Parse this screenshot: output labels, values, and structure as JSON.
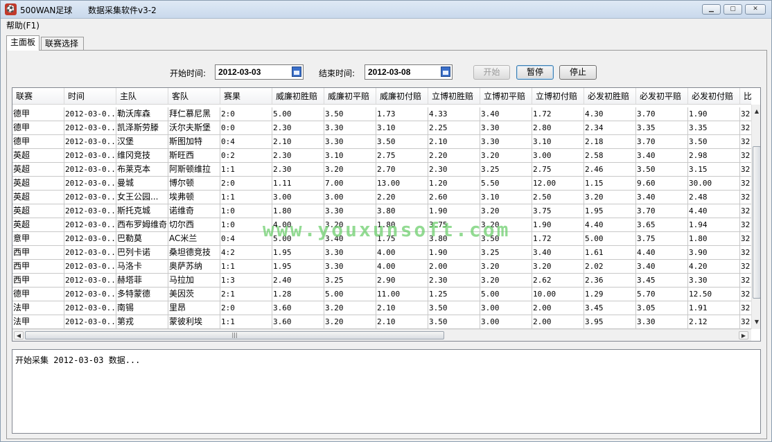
{
  "window": {
    "app_title": "500WAN足球",
    "doc_title": "数据采集软件v3-2",
    "icon_name": "app-logo-icon"
  },
  "menu": {
    "help": "帮助(F1)"
  },
  "tabs": [
    {
      "label": "主面板",
      "active": true
    },
    {
      "label": "联赛选择",
      "active": false
    }
  ],
  "controls": {
    "start_label": "开始时间:",
    "start_date": "2012-03-03",
    "end_label": "结束时间:",
    "end_date": "2012-03-08",
    "btn_start": "开始",
    "btn_pause": "暂停",
    "btn_stop": "停止"
  },
  "table": {
    "columns": [
      "联赛",
      "时间",
      "主队",
      "客队",
      "赛果",
      "威廉初胜赔",
      "威廉初平赔",
      "威廉初付赔",
      "立博初胜赔",
      "立博初平赔",
      "立博初付赔",
      "必发初胜赔",
      "必发初平赔",
      "必发初付赔",
      "比"
    ],
    "rows": [
      [
        "德甲",
        "2012-03-0...",
        "勒沃库森",
        "拜仁慕尼黑",
        "2:0",
        "5.00",
        "3.50",
        "1.73",
        "4.33",
        "3.40",
        "1.72",
        "4.30",
        "3.70",
        "1.90",
        "32"
      ],
      [
        "德甲",
        "2012-03-0...",
        "凯泽斯劳滕",
        "沃尔夫斯堡",
        "0:0",
        "2.30",
        "3.30",
        "3.10",
        "2.25",
        "3.30",
        "2.80",
        "2.34",
        "3.35",
        "3.35",
        "32"
      ],
      [
        "德甲",
        "2012-03-0...",
        "汉堡",
        "斯图加特",
        "0:4",
        "2.10",
        "3.30",
        "3.50",
        "2.10",
        "3.30",
        "3.10",
        "2.18",
        "3.70",
        "3.50",
        "32"
      ],
      [
        "英超",
        "2012-03-0...",
        "维冈竞技",
        "斯旺西",
        "0:2",
        "2.30",
        "3.10",
        "2.75",
        "2.20",
        "3.20",
        "3.00",
        "2.58",
        "3.40",
        "2.98",
        "32"
      ],
      [
        "英超",
        "2012-03-0...",
        "布莱克本",
        "阿斯顿维拉",
        "1:1",
        "2.30",
        "3.20",
        "2.70",
        "2.30",
        "3.25",
        "2.75",
        "2.46",
        "3.50",
        "3.15",
        "32"
      ],
      [
        "英超",
        "2012-03-0...",
        "曼城",
        "博尔顿",
        "2:0",
        "1.11",
        "7.00",
        "13.00",
        "1.20",
        "5.50",
        "12.00",
        "1.15",
        "9.60",
        "30.00",
        "32"
      ],
      [
        "英超",
        "2012-03-0...",
        "女王公园...",
        "埃弗顿",
        "1:1",
        "3.00",
        "3.00",
        "2.20",
        "2.60",
        "3.10",
        "2.50",
        "3.20",
        "3.40",
        "2.48",
        "32"
      ],
      [
        "英超",
        "2012-03-0...",
        "斯托克城",
        "诺维奇",
        "1:0",
        "1.80",
        "3.30",
        "3.80",
        "1.90",
        "3.20",
        "3.75",
        "1.95",
        "3.70",
        "4.40",
        "32"
      ],
      [
        "英超",
        "2012-03-0...",
        "西布罗姆维奇",
        "切尔西",
        "1:0",
        "4.00",
        "3.20",
        "1.80",
        "3.75",
        "3.20",
        "1.90",
        "4.40",
        "3.65",
        "1.94",
        "32"
      ],
      [
        "意甲",
        "2012-03-0...",
        "巴勒莫",
        "AC米兰",
        "0:4",
        "5.00",
        "3.40",
        "1.75",
        "3.80",
        "3.50",
        "1.72",
        "5.00",
        "3.75",
        "1.80",
        "32"
      ],
      [
        "西甲",
        "2012-03-0...",
        "巴列卡诺",
        "桑坦德竞技",
        "4:2",
        "1.95",
        "3.30",
        "4.00",
        "1.90",
        "3.25",
        "3.40",
        "1.61",
        "4.40",
        "3.90",
        "32"
      ],
      [
        "西甲",
        "2012-03-0...",
        "马洛卡",
        "奥萨苏纳",
        "1:1",
        "1.95",
        "3.30",
        "4.00",
        "2.00",
        "3.20",
        "3.20",
        "2.02",
        "3.40",
        "4.20",
        "32"
      ],
      [
        "西甲",
        "2012-03-0...",
        "赫塔菲",
        "马拉加",
        "1:3",
        "2.40",
        "3.25",
        "2.90",
        "2.30",
        "3.20",
        "2.62",
        "2.36",
        "3.45",
        "3.30",
        "32"
      ],
      [
        "德甲",
        "2012-03-0...",
        "多特蒙德",
        "美因茨",
        "2:1",
        "1.28",
        "5.00",
        "11.00",
        "1.25",
        "5.00",
        "10.00",
        "1.29",
        "5.70",
        "12.50",
        "32"
      ],
      [
        "法甲",
        "2012-03-0...",
        "南锡",
        "里昂",
        "2:0",
        "3.60",
        "3.20",
        "2.10",
        "3.50",
        "3.00",
        "2.00",
        "3.45",
        "3.05",
        "1.91",
        "32"
      ],
      [
        "法甲",
        "2012-03-0...",
        "第戎",
        "蒙彼利埃",
        "1:1",
        "3.60",
        "3.20",
        "2.10",
        "3.50",
        "3.00",
        "2.00",
        "3.95",
        "3.30",
        "2.12",
        "32"
      ]
    ]
  },
  "watermark": "www.youxunsoft.com",
  "log": {
    "text": "开始采集 2012-03-03 数据..."
  },
  "colors": {
    "titlebar": "#c9d9ec",
    "watermark": "#6fd06f",
    "grid_line": "#c8c8c8"
  }
}
